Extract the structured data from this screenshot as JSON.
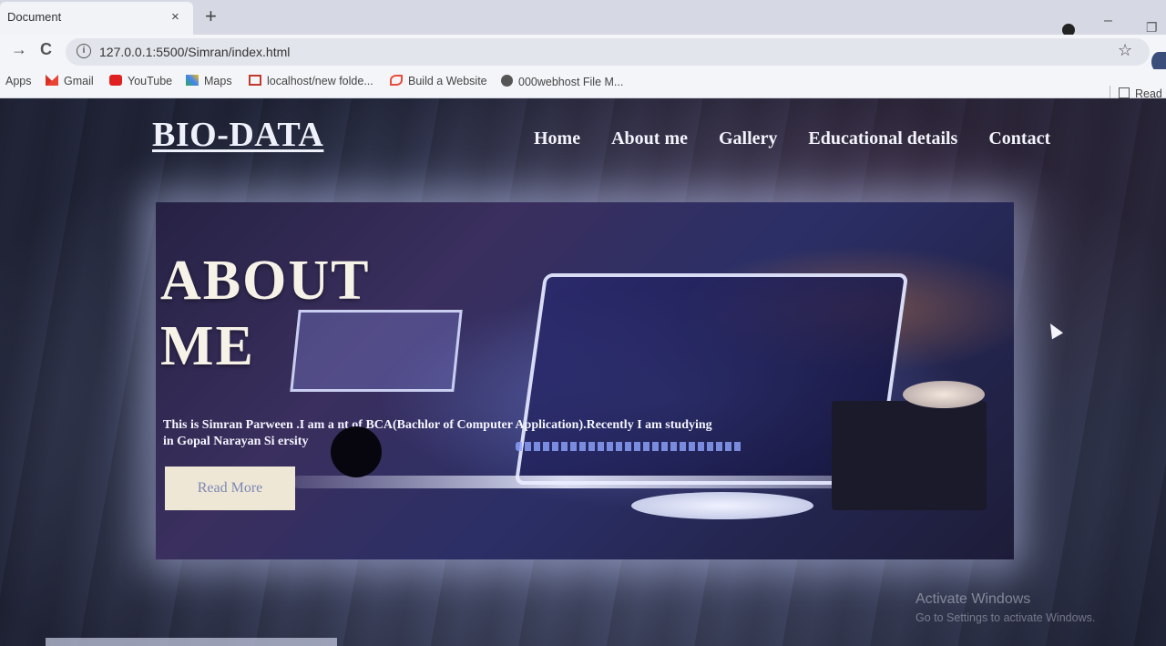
{
  "browser": {
    "tab_title": "Document",
    "tab_close": "×",
    "new_tab": "+",
    "url": "127.0.0.1:5500/Simran/index.html",
    "info_icon": "i",
    "star": "☆",
    "window_min": "–",
    "window_max": "❐",
    "back": "→",
    "reload": "C",
    "bookmarks": [
      {
        "label": "Apps",
        "icon": "apps-icon",
        "color": "#3a3a3a"
      },
      {
        "label": "Gmail",
        "icon": "gmail-icon",
        "color": "#d93025"
      },
      {
        "label": "YouTube",
        "icon": "youtube-icon",
        "color": "#e02020"
      },
      {
        "label": "Maps",
        "icon": "maps-icon",
        "color": "#34a853"
      },
      {
        "label": "localhost/new folde...",
        "icon": "localhost-icon",
        "color": "#c0392b"
      },
      {
        "label": "Build a Website",
        "icon": "build-icon",
        "color": "#e74c3c"
      },
      {
        "label": "000webhost File M...",
        "icon": "globe-icon",
        "color": "#444444"
      }
    ],
    "reading_list": "Read"
  },
  "site": {
    "logo": "BIO-DATA",
    "nav": [
      {
        "label": "Home"
      },
      {
        "label": "About me"
      },
      {
        "label": "Gallery"
      },
      {
        "label": "Educational details"
      },
      {
        "label": "Contact"
      }
    ]
  },
  "hero": {
    "title_line1": "ABOUT",
    "title_line2": "ME",
    "text": "This is Simran Parween .I am a       nt of BCA(Bachlor of Computer Application).Recently I am studying in Gopal Narayan Si              ersity",
    "button": "Read More"
  },
  "watermark": {
    "title": "Activate Windows",
    "subtitle": "Go to Settings to activate Windows."
  }
}
